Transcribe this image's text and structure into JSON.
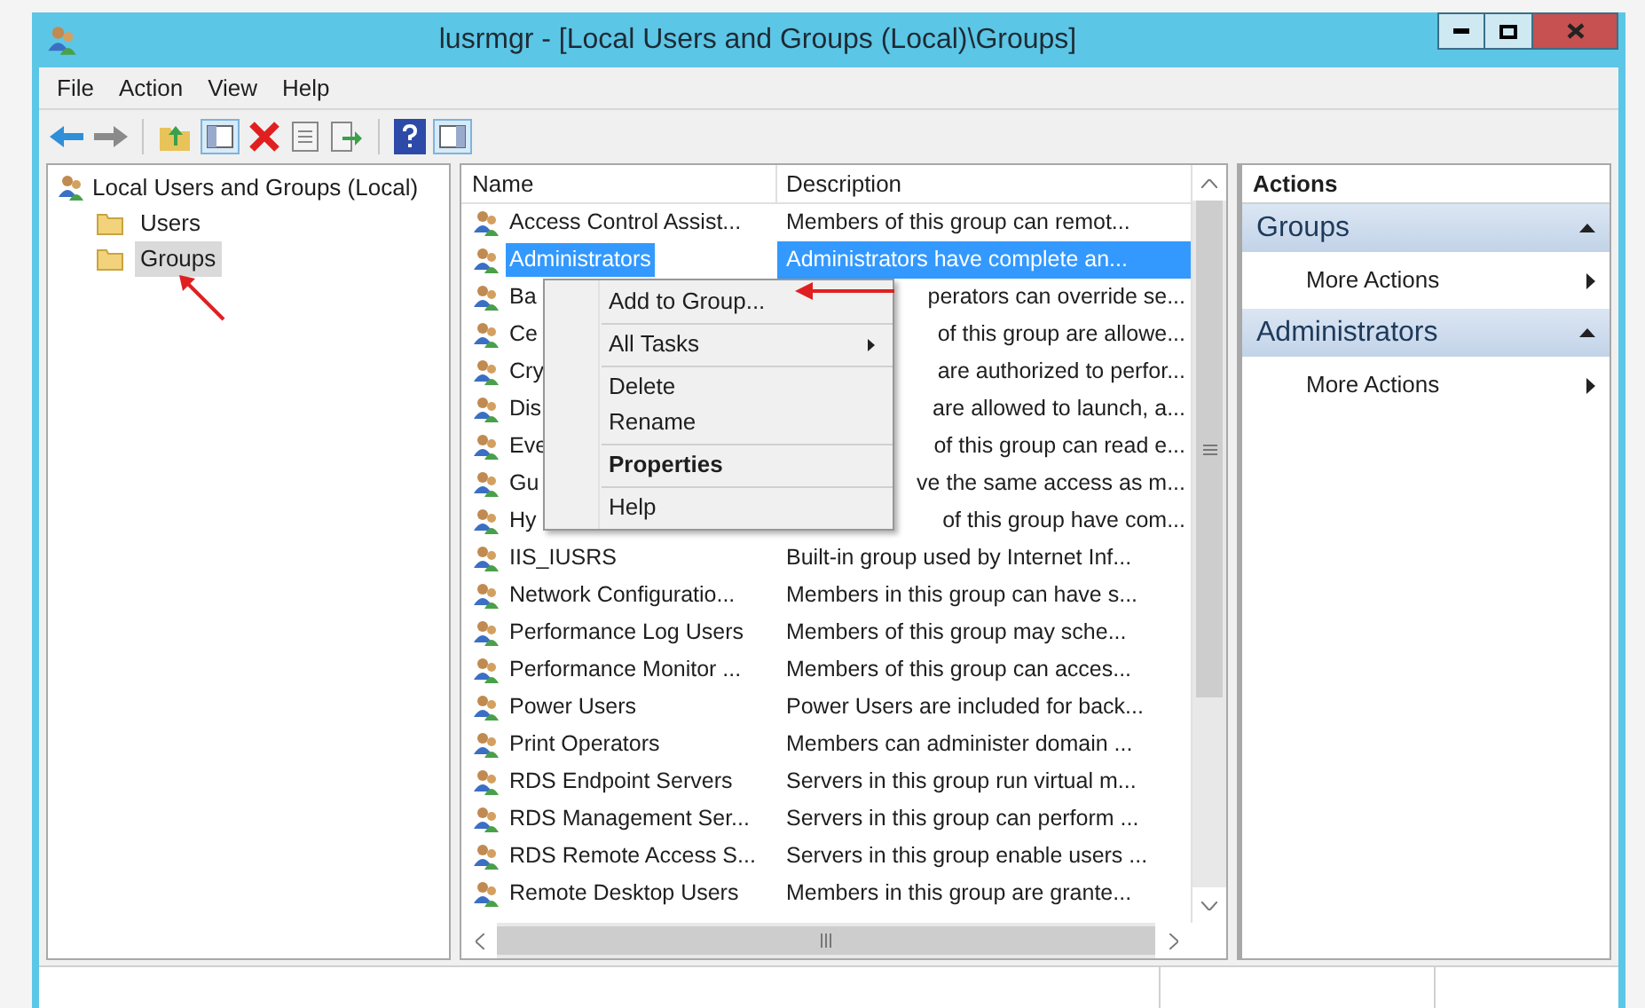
{
  "window": {
    "title": "lusrmgr - [Local Users and Groups (Local)\\Groups]"
  },
  "menu_bar": [
    "File",
    "Action",
    "View",
    "Help"
  ],
  "tree": {
    "label": "Local Users and Groups (Local)",
    "children": [
      {
        "label": "Users",
        "selected": false
      },
      {
        "label": "Groups",
        "selected": true
      }
    ]
  },
  "list": {
    "columns": [
      "Name",
      "Description"
    ],
    "rows": [
      {
        "name": "Access Control Assist...",
        "description": "Members of this group can remot...",
        "selected": false,
        "partial": false
      },
      {
        "name": "Administrators",
        "description": "Administrators have complete an...",
        "selected": true,
        "partial": false
      },
      {
        "name": "Ba",
        "description": "perators can override se...",
        "selected": false,
        "partial": true
      },
      {
        "name": "Ce",
        "description": "of this group are allowe...",
        "selected": false,
        "partial": true
      },
      {
        "name": "Cry",
        "description": "are authorized to perfor...",
        "selected": false,
        "partial": true
      },
      {
        "name": "Dis",
        "description": "are allowed to launch, a...",
        "selected": false,
        "partial": true
      },
      {
        "name": "Eve",
        "description": "of this group can read e...",
        "selected": false,
        "partial": true
      },
      {
        "name": "Gu",
        "description": "ve the same access as m...",
        "selected": false,
        "partial": true
      },
      {
        "name": "Hy",
        "description": "of this group have com...",
        "selected": false,
        "partial": true
      },
      {
        "name": "IIS_IUSRS",
        "description": "Built-in group used by Internet Inf...",
        "selected": false,
        "partial": false
      },
      {
        "name": "Network Configuratio...",
        "description": "Members in this group can have s...",
        "selected": false,
        "partial": false
      },
      {
        "name": "Performance Log Users",
        "description": "Members of this group may sche...",
        "selected": false,
        "partial": false
      },
      {
        "name": "Performance Monitor ...",
        "description": "Members of this group can acces...",
        "selected": false,
        "partial": false
      },
      {
        "name": "Power Users",
        "description": "Power Users are included for back...",
        "selected": false,
        "partial": false
      },
      {
        "name": "Print Operators",
        "description": "Members can administer domain ...",
        "selected": false,
        "partial": false
      },
      {
        "name": "RDS Endpoint Servers",
        "description": "Servers in this group run virtual m...",
        "selected": false,
        "partial": false
      },
      {
        "name": "RDS Management Ser...",
        "description": "Servers in this group can perform ...",
        "selected": false,
        "partial": false
      },
      {
        "name": "RDS Remote Access S...",
        "description": "Servers in this group enable users ...",
        "selected": false,
        "partial": false
      },
      {
        "name": "Remote Desktop Users",
        "description": "Members in this group are grante...",
        "selected": false,
        "partial": false
      }
    ]
  },
  "context_menu": [
    {
      "kind": "item",
      "label": "Add to Group...",
      "bold": false,
      "submenu": false
    },
    {
      "kind": "separator"
    },
    {
      "kind": "item",
      "label": "All Tasks",
      "bold": false,
      "submenu": true
    },
    {
      "kind": "separator"
    },
    {
      "kind": "item",
      "label": "Delete",
      "bold": false,
      "submenu": false
    },
    {
      "kind": "item",
      "label": "Rename",
      "bold": false,
      "submenu": false
    },
    {
      "kind": "separator"
    },
    {
      "kind": "item",
      "label": "Properties",
      "bold": true,
      "submenu": false
    },
    {
      "kind": "separator"
    },
    {
      "kind": "item",
      "label": "Help",
      "bold": false,
      "submenu": false
    }
  ],
  "actions": {
    "title": "Actions",
    "sections": [
      {
        "title": "Groups",
        "items": [
          "More Actions"
        ]
      },
      {
        "title": "Administrators",
        "items": [
          "More Actions"
        ]
      }
    ]
  }
}
